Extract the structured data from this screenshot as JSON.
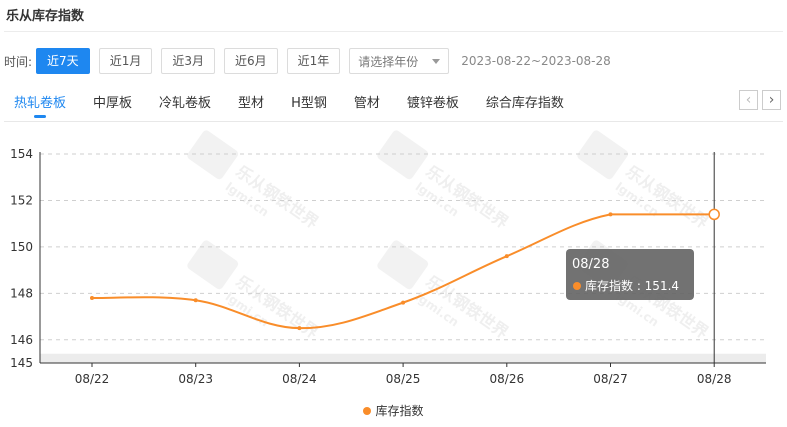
{
  "header": {
    "title": "乐从库存指数"
  },
  "filters": {
    "label": "时间:",
    "buttons": [
      "近7天",
      "近1月",
      "近3月",
      "近6月",
      "近1年"
    ],
    "active_index": 0,
    "year_select_placeholder": "请选择年份",
    "date_range": "2023-08-22~2023-08-28"
  },
  "tabs": {
    "items": [
      "热轧卷板",
      "中厚板",
      "冷轧卷板",
      "型材",
      "H型钢",
      "管材",
      "镀锌卷板",
      "综合库存指数"
    ],
    "active_index": 0,
    "prev": "‹",
    "next": "›"
  },
  "watermark": {
    "text": "乐从钢铁世界",
    "url": "lgmi.cn"
  },
  "tooltip": {
    "date": "08/28",
    "series": "库存指数",
    "value": "151.4"
  },
  "colors": {
    "accent": "#1e87f0",
    "line": "#f98d2a",
    "tooltip_bg": "#666666"
  },
  "chart_data": {
    "type": "line",
    "categories": [
      "08/22",
      "08/23",
      "08/24",
      "08/25",
      "08/26",
      "08/27",
      "08/28"
    ],
    "series": [
      {
        "name": "库存指数",
        "values": [
          147.8,
          147.7,
          146.5,
          147.6,
          149.6,
          151.4,
          151.4
        ]
      }
    ],
    "ylim": [
      145,
      154
    ],
    "yticks": [
      145,
      146,
      148,
      150,
      152,
      154
    ],
    "grid": true,
    "legend": "bottom-center"
  }
}
